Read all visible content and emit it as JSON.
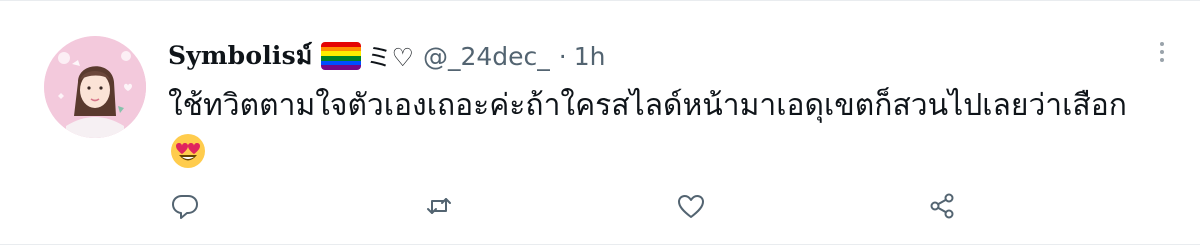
{
  "tweet": {
    "display_name": "Symbolisม์",
    "name_symbols": "ミ♡",
    "handle": "@_24dec_",
    "separator": "·",
    "time": "1h",
    "text": "ใช้ทวิตตามใจตัวเองเถอะค่ะถ้าใครสไลด์หน้ามาเอดุเขตก็สวนไปเลยว่าเสือก",
    "emoji_icon": "heart-eyes-emoji",
    "flag_icon": "rainbow-flag"
  },
  "actions": {
    "reply_icon": "reply-icon",
    "retweet_icon": "retweet-icon",
    "like_icon": "like-icon",
    "share_icon": "share-icon"
  },
  "colors": {
    "text": "#0f1419",
    "secondary": "#536471",
    "icon": "#536471",
    "border": "#e9ecef"
  }
}
